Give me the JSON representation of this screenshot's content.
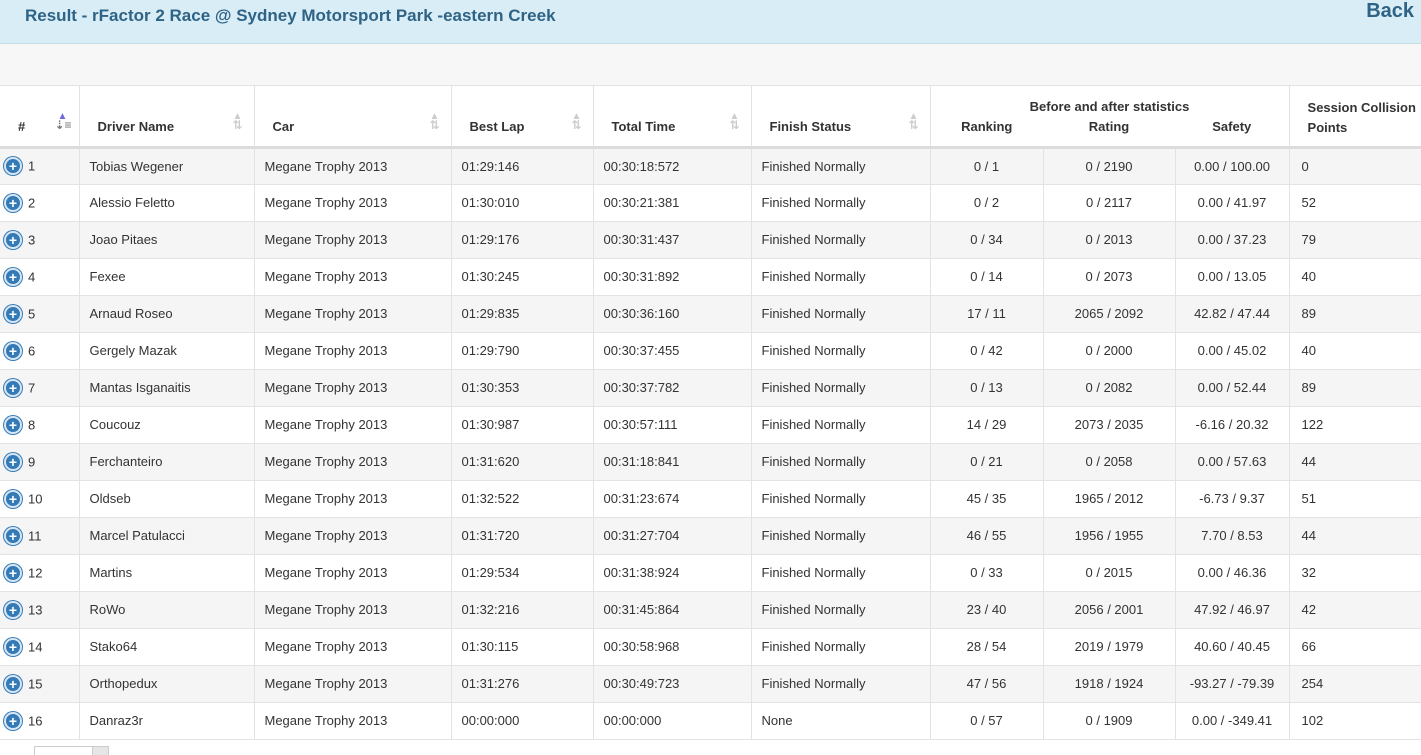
{
  "header": {
    "title": "Result - rFactor 2 Race @ Sydney Motorsport Park -eastern Creek",
    "back_label": "Back"
  },
  "table": {
    "columns": {
      "num": "#",
      "driver": "Driver Name",
      "car": "Car",
      "best_lap": "Best Lap",
      "total_time": "Total Time",
      "finish_status": "Finish Status",
      "stats_group": "Before and after statistics",
      "ranking": "Ranking",
      "rating": "Rating",
      "safety": "Safety",
      "collision": "Session Collision Points"
    },
    "rows": [
      {
        "pos": "1",
        "driver": "Tobias Wegener",
        "car": "Megane Trophy 2013",
        "best": "01:29:146",
        "total": "00:30:18:572",
        "status": "Finished Normally",
        "ranking": "0 / 1",
        "rating": "0 / 2190",
        "safety": "0.00 / 100.00",
        "points": "0"
      },
      {
        "pos": "2",
        "driver": "Alessio Feletto",
        "car": "Megane Trophy 2013",
        "best": "01:30:010",
        "total": "00:30:21:381",
        "status": "Finished Normally",
        "ranking": "0 / 2",
        "rating": "0 / 2117",
        "safety": "0.00 / 41.97",
        "points": "52"
      },
      {
        "pos": "3",
        "driver": "Joao Pitaes",
        "car": "Megane Trophy 2013",
        "best": "01:29:176",
        "total": "00:30:31:437",
        "status": "Finished Normally",
        "ranking": "0 / 34",
        "rating": "0 / 2013",
        "safety": "0.00 / 37.23",
        "points": "79"
      },
      {
        "pos": "4",
        "driver": "Fexee",
        "car": "Megane Trophy 2013",
        "best": "01:30:245",
        "total": "00:30:31:892",
        "status": "Finished Normally",
        "ranking": "0 / 14",
        "rating": "0 / 2073",
        "safety": "0.00 / 13.05",
        "points": "40"
      },
      {
        "pos": "5",
        "driver": "Arnaud Roseo",
        "car": "Megane Trophy 2013",
        "best": "01:29:835",
        "total": "00:30:36:160",
        "status": "Finished Normally",
        "ranking": "17 / 11",
        "rating": "2065 / 2092",
        "safety": "42.82 / 47.44",
        "points": "89"
      },
      {
        "pos": "6",
        "driver": "Gergely Mazak",
        "car": "Megane Trophy 2013",
        "best": "01:29:790",
        "total": "00:30:37:455",
        "status": "Finished Normally",
        "ranking": "0 / 42",
        "rating": "0 / 2000",
        "safety": "0.00 / 45.02",
        "points": "40"
      },
      {
        "pos": "7",
        "driver": "Mantas Isganaitis",
        "car": "Megane Trophy 2013",
        "best": "01:30:353",
        "total": "00:30:37:782",
        "status": "Finished Normally",
        "ranking": "0 / 13",
        "rating": "0 / 2082",
        "safety": "0.00 / 52.44",
        "points": "89"
      },
      {
        "pos": "8",
        "driver": "Coucouz",
        "car": "Megane Trophy 2013",
        "best": "01:30:987",
        "total": "00:30:57:111",
        "status": "Finished Normally",
        "ranking": "14 / 29",
        "rating": "2073 / 2035",
        "safety": "-6.16 / 20.32",
        "points": "122"
      },
      {
        "pos": "9",
        "driver": "Ferchanteiro",
        "car": "Megane Trophy 2013",
        "best": "01:31:620",
        "total": "00:31:18:841",
        "status": "Finished Normally",
        "ranking": "0 / 21",
        "rating": "0 / 2058",
        "safety": "0.00 / 57.63",
        "points": "44"
      },
      {
        "pos": "10",
        "driver": "Oldseb",
        "car": "Megane Trophy 2013",
        "best": "01:32:522",
        "total": "00:31:23:674",
        "status": "Finished Normally",
        "ranking": "45 / 35",
        "rating": "1965 / 2012",
        "safety": "-6.73 / 9.37",
        "points": "51"
      },
      {
        "pos": "11",
        "driver": "Marcel Patulacci",
        "car": "Megane Trophy 2013",
        "best": "01:31:720",
        "total": "00:31:27:704",
        "status": "Finished Normally",
        "ranking": "46 / 55",
        "rating": "1956 / 1955",
        "safety": "7.70 / 8.53",
        "points": "44"
      },
      {
        "pos": "12",
        "driver": "Martins",
        "car": "Megane Trophy 2013",
        "best": "01:29:534",
        "total": "00:31:38:924",
        "status": "Finished Normally",
        "ranking": "0 / 33",
        "rating": "0 / 2015",
        "safety": "0.00 / 46.36",
        "points": "32"
      },
      {
        "pos": "13",
        "driver": "RoWo",
        "car": "Megane Trophy 2013",
        "best": "01:32:216",
        "total": "00:31:45:864",
        "status": "Finished Normally",
        "ranking": "23 / 40",
        "rating": "2056 / 2001",
        "safety": "47.92 / 46.97",
        "points": "42"
      },
      {
        "pos": "14",
        "driver": "Stako64",
        "car": "Megane Trophy 2013",
        "best": "01:30:115",
        "total": "00:30:58:968",
        "status": "Finished Normally",
        "ranking": "28 / 54",
        "rating": "2019 / 1979",
        "safety": "40.60 / 40.45",
        "points": "66"
      },
      {
        "pos": "15",
        "driver": "Orthopedux",
        "car": "Megane Trophy 2013",
        "best": "01:31:276",
        "total": "00:30:49:723",
        "status": "Finished Normally",
        "ranking": "47 / 56",
        "rating": "1918 / 1924",
        "safety": "-93.27 / -79.39",
        "points": "254"
      },
      {
        "pos": "16",
        "driver": "Danraz3r",
        "car": "Megane Trophy 2013",
        "best": "00:00:000",
        "total": "00:00:000",
        "status": "None",
        "ranking": "0 / 57",
        "rating": "0 / 1909",
        "safety": "0.00 / -349.41",
        "points": "102"
      }
    ]
  }
}
